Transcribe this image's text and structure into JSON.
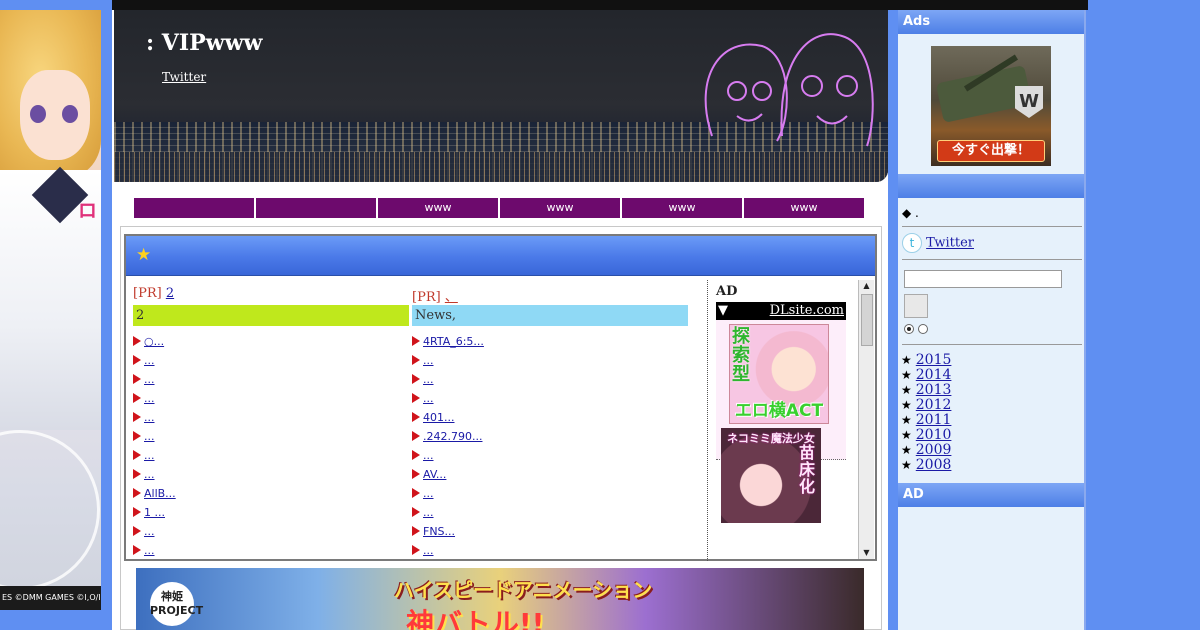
{
  "left_ad": {
    "vertical_text": "ロ",
    "credit": "ES ©DMM GAMES ©I,O/I"
  },
  "header": {
    "title": ": VIPwww",
    "twitter_link": "Twitter"
  },
  "nav": {
    "items": [
      "",
      "",
      "www",
      "www",
      "www",
      "www"
    ]
  },
  "box": {
    "star": "★",
    "col_a": {
      "pr_tag": "[PR]",
      "pr_link": "2",
      "title": "2",
      "links": [
        "○...",
        "...",
        "...",
        "...",
        "...",
        "...",
        "...",
        "...",
        "AllB...",
        "1 ...",
        "...",
        "..."
      ]
    },
    "col_b": {
      "pr_tag": "[PR]",
      "pr_link": "、",
      "title": "News,",
      "links": [
        "4RTA_6:5...",
        "...",
        "...",
        "...",
        "401...",
        ".242.790...",
        "...",
        "AV...",
        "...",
        "...",
        "FNS...",
        "..."
      ]
    },
    "ad_col": {
      "label": "AD",
      "dl_arrow": "▼",
      "dl_link": "DLsite.com",
      "ad1_vertical": "探索型",
      "ad1_bottom": "エロ横ACT",
      "ad2_top": "ネコミミ魔法少女",
      "ad2_vertical": "苗床化"
    },
    "scroll_up": "▲",
    "scroll_down": "▼"
  },
  "banner": {
    "logo": "神姫 PROJECT",
    "headline": "ハイスピードアニメーション",
    "big": "神バトル!!"
  },
  "sidebar": {
    "ads_head": "Ads",
    "tank_cta": "今すぐ出撃！",
    "wot_logo": "W",
    "section2_head": "",
    "diamond_line": "◆ .",
    "twitter_icon": "t",
    "twitter_label": " Twitter ",
    "archive_bullet": "★",
    "archive": [
      "2015",
      "2014",
      "2013",
      "2012",
      "2011",
      "2010",
      "2009",
      "2008"
    ],
    "ad_head": "AD"
  }
}
